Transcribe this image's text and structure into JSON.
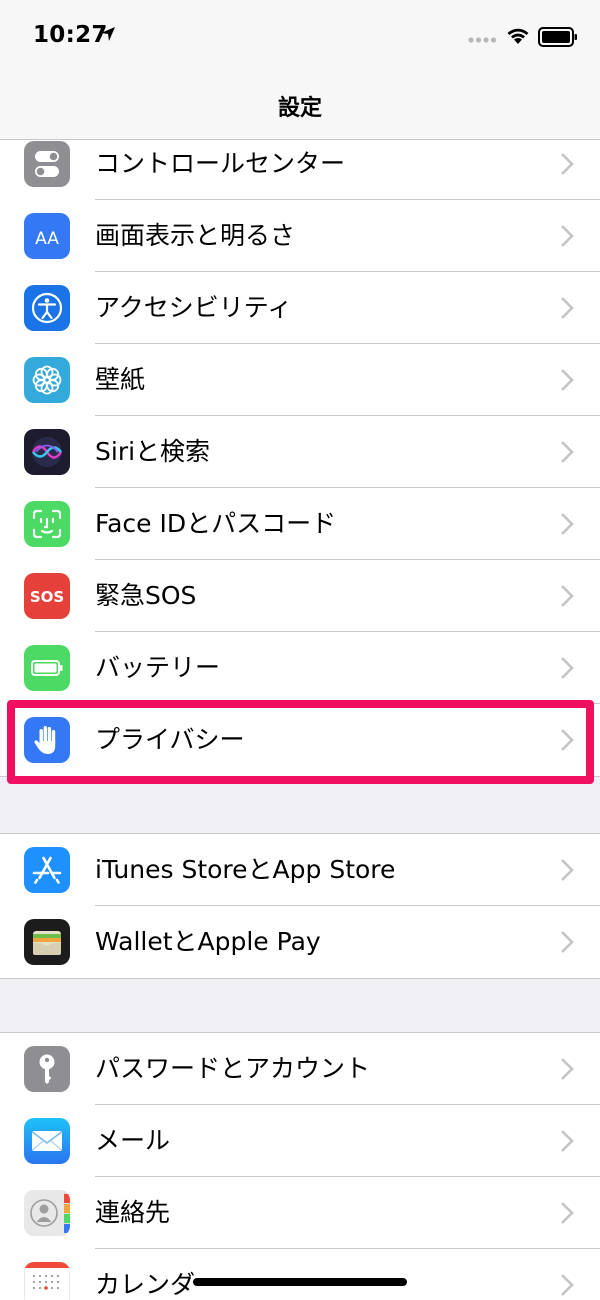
{
  "status_bar": {
    "time": "10:27"
  },
  "nav": {
    "title": "設定"
  },
  "sections": [
    {
      "rows": [
        {
          "label": "コントロールセンター",
          "icon": "control-center-icon",
          "color": "#8e8e93"
        },
        {
          "label": "画面表示と明るさ",
          "icon": "display-brightness-icon",
          "color": "#3478f6"
        },
        {
          "label": "アクセシビリティ",
          "icon": "accessibility-icon",
          "color": "#1a74e8"
        },
        {
          "label": "壁紙",
          "icon": "wallpaper-icon",
          "color": "#34aadc"
        },
        {
          "label": "Siriと検索",
          "icon": "siri-icon",
          "color": "#1c1c2e"
        },
        {
          "label": "Face IDとパスコード",
          "icon": "face-id-icon",
          "color": "#4cd964"
        },
        {
          "label": "緊急SOS",
          "icon": "sos-icon",
          "color": "#e5413a"
        },
        {
          "label": "バッテリー",
          "icon": "battery-settings-icon",
          "color": "#4cd964"
        },
        {
          "label": "プライバシー",
          "icon": "privacy-hand-icon",
          "color": "#3478f6"
        }
      ]
    },
    {
      "rows": [
        {
          "label": "iTunes StoreとApp Store",
          "icon": "app-store-icon",
          "color": "#1e90ff"
        },
        {
          "label": "WalletとApple Pay",
          "icon": "wallet-icon",
          "color": "#1c1c1c"
        }
      ]
    },
    {
      "rows": [
        {
          "label": "パスワードとアカウント",
          "icon": "key-icon",
          "color": "#8e8e93"
        },
        {
          "label": "メール",
          "icon": "mail-icon",
          "color": "#2a8cf5"
        },
        {
          "label": "連絡先",
          "icon": "contacts-icon",
          "color": "#d9d9d9"
        },
        {
          "label": "カレンダー",
          "icon": "calendar-icon",
          "color": "#ffffff"
        }
      ]
    }
  ],
  "highlight_color": "#f0105f"
}
